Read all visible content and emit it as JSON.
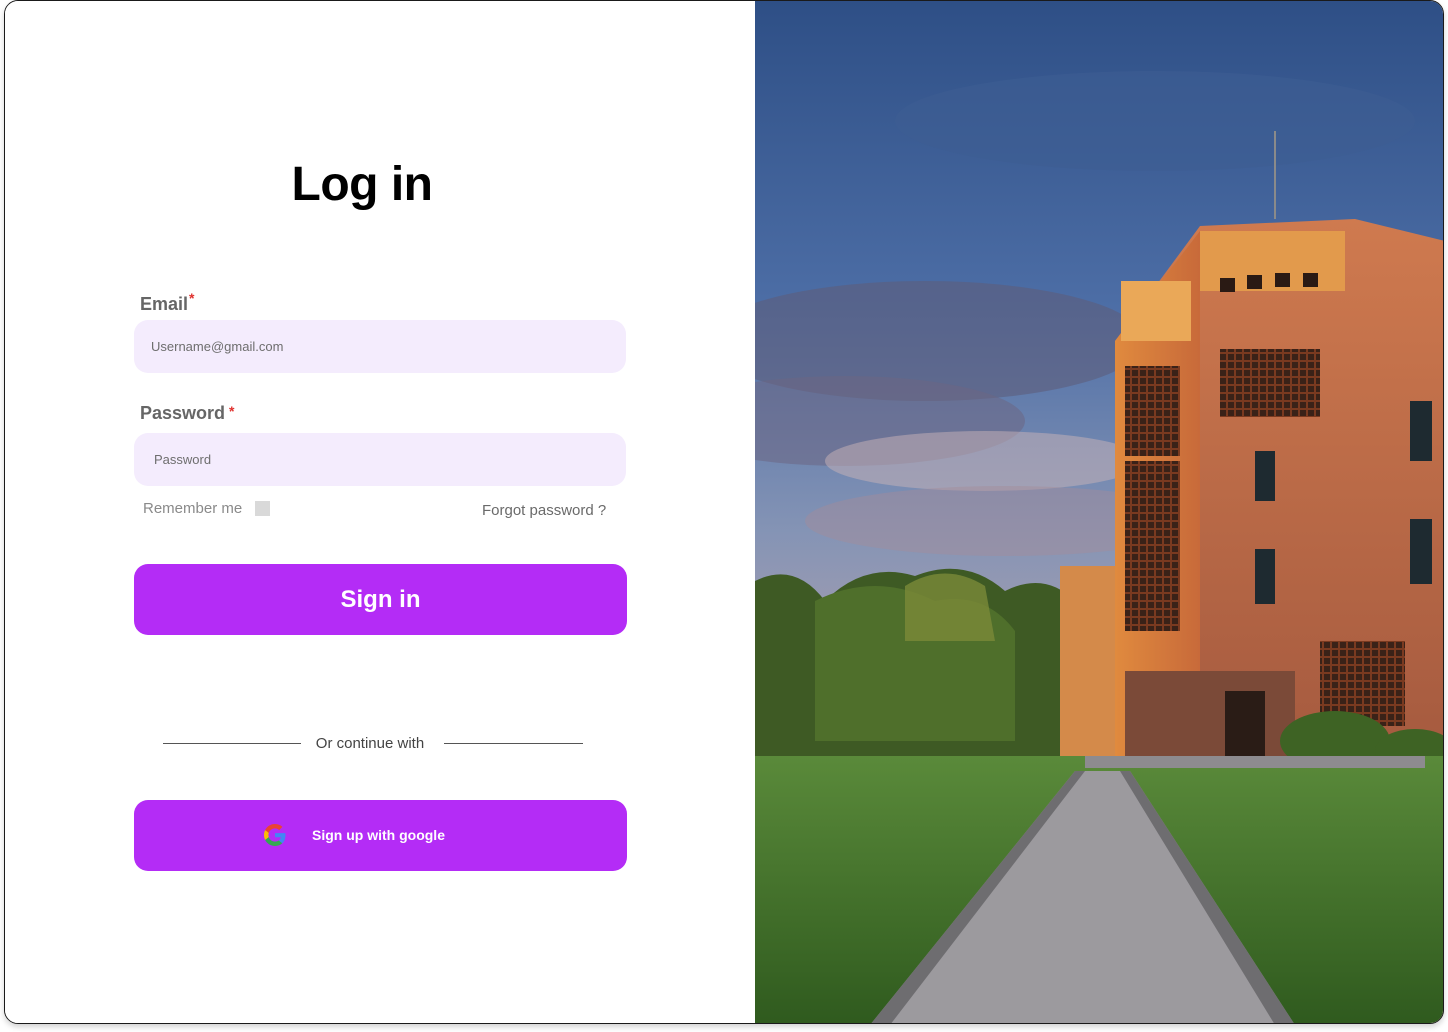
{
  "login": {
    "title": "Log in",
    "email_label": "Email",
    "email_required_mark": "*",
    "email_placeholder": "Username@gmail.com",
    "password_label": "Password",
    "password_required_mark": "*",
    "password_placeholder": "Password",
    "remember_label": "Remember me",
    "remember_checked": false,
    "forgot_label": "Forgot password ?",
    "signin_label": "Sign in",
    "divider_text": "Or continue with",
    "google_label": "Sign up with google",
    "google_icon": "google-g-icon"
  },
  "colors": {
    "accent": "#b42cf6",
    "input_bg": "#f4ecfd",
    "required": "#e0312e"
  }
}
